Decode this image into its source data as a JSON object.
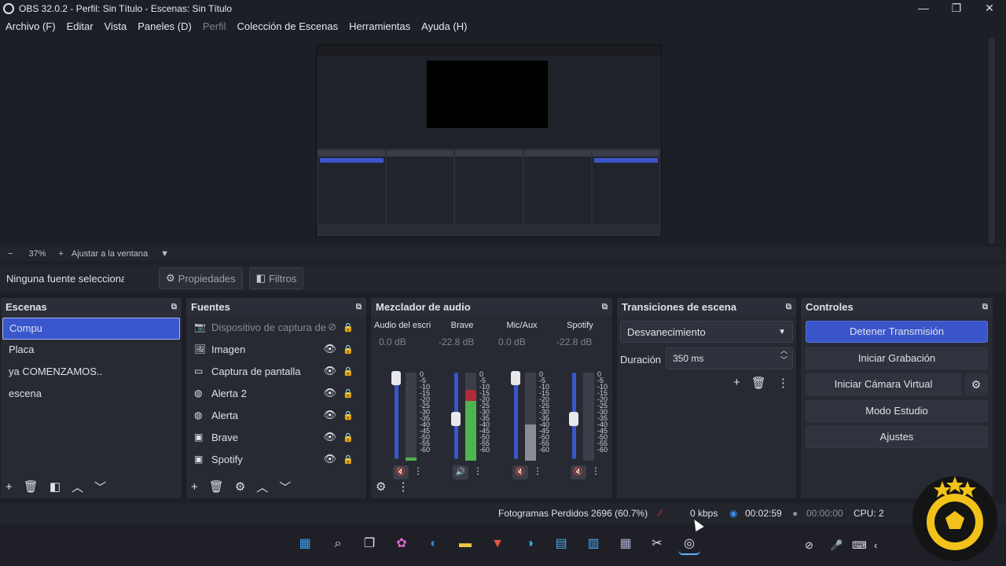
{
  "window": {
    "title": "OBS 32.0.2 - Perfil: Sin Título - Escenas: Sin Título",
    "minimize": "—",
    "maximize": "❐",
    "close": "✕"
  },
  "menu": [
    "Archivo (F)",
    "Editar",
    "Vista",
    "Paneles (D)",
    "Perfil",
    "Colección de Escenas",
    "Herramientas",
    "Ayuda (H)"
  ],
  "zoom": {
    "minus": "−",
    "level": "37%",
    "plus": "+",
    "fit_label": "Ajustar a la ventana",
    "dropdown": "▼"
  },
  "source_toolbar": {
    "no_source": "Ninguna fuente seleccionada",
    "properties": "Propiedades",
    "filters": "Filtros"
  },
  "scenes": {
    "title": "Escenas",
    "items": [
      "Compu",
      "Placa",
      "ya COMENZAMOS..",
      "escena"
    ],
    "active_index": 0
  },
  "sources": {
    "title": "Fuentes",
    "items": [
      {
        "label": "Dispositivo de captura de vídeo",
        "icon": "camera-icon",
        "visible": false
      },
      {
        "label": "Imagen",
        "icon": "image-icon",
        "visible": true
      },
      {
        "label": "Captura de pantalla",
        "icon": "monitor-icon",
        "visible": true
      },
      {
        "label": "Alerta 2",
        "icon": "globe-icon",
        "visible": true
      },
      {
        "label": "Alerta",
        "icon": "globe-icon",
        "visible": true
      },
      {
        "label": "Brave",
        "icon": "window-icon",
        "visible": true
      },
      {
        "label": "Spotify",
        "icon": "window-icon",
        "visible": true
      }
    ]
  },
  "mixer": {
    "title": "Mezclador de audio",
    "channels": [
      {
        "name": "Audio del escritorio",
        "db": "0.0 dB",
        "level": 0.05,
        "muted": true,
        "fader": 0.95
      },
      {
        "name": "Brave",
        "db": "-22.8 dB",
        "level": 0.8,
        "muted": false,
        "fader": 0.45
      },
      {
        "name": "Mic/Aux",
        "db": "0.0 dB",
        "level": 0.4,
        "muted": true,
        "fader": 0.95
      },
      {
        "name": "Spotify",
        "db": "-22.8 dB",
        "level": 0.0,
        "muted": true,
        "fader": 0.45
      }
    ],
    "scale": [
      "0",
      "-5",
      "-10",
      "-15",
      "-20",
      "-25",
      "-30",
      "-35",
      "-40",
      "-45",
      "-50",
      "-55",
      "-60"
    ]
  },
  "transitions": {
    "title": "Transiciones de escena",
    "selected": "Desvanecimiento",
    "duration_label": "Duración",
    "duration_value": "350 ms"
  },
  "controls": {
    "title": "Controles",
    "stop_stream": "Detener Transmisión",
    "start_recording": "Iniciar Grabación",
    "virtual_camera": "Iniciar Cámara Virtual",
    "studio_mode": "Modo Estudio",
    "settings": "Ajustes"
  },
  "status": {
    "dropped_frames": "Fotogramas Perdidos 2696 (60.7%)",
    "bitrate": "0 kbps",
    "stream_time": "00:02:59",
    "record_time": "00:00:00",
    "cpu": "CPU: 2"
  },
  "colors": {
    "accent": "#3956cc",
    "danger": "#c62a3c",
    "meter_green": "#4fb34f",
    "meter_red": "#b02a3a"
  }
}
